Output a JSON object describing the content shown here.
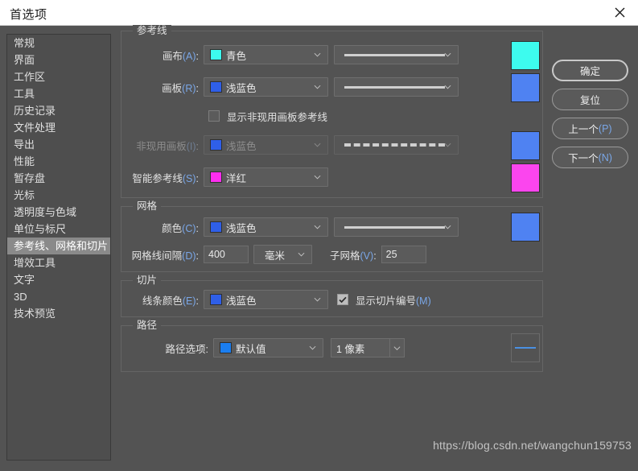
{
  "window": {
    "title": "首选项",
    "close_icon": "close-icon"
  },
  "sidebar": {
    "items": [
      {
        "label": "常规",
        "selected": false
      },
      {
        "label": "界面",
        "selected": false
      },
      {
        "label": "工作区",
        "selected": false
      },
      {
        "label": "工具",
        "selected": false
      },
      {
        "label": "历史记录",
        "selected": false
      },
      {
        "label": "文件处理",
        "selected": false
      },
      {
        "label": "导出",
        "selected": false
      },
      {
        "label": "性能",
        "selected": false
      },
      {
        "label": "暂存盘",
        "selected": false
      },
      {
        "label": "光标",
        "selected": false
      },
      {
        "label": "透明度与色域",
        "selected": false
      },
      {
        "label": "单位与标尺",
        "selected": false
      },
      {
        "label": "参考线、网格和切片",
        "selected": true
      },
      {
        "label": "增效工具",
        "selected": false
      },
      {
        "label": "文字",
        "selected": false
      },
      {
        "label": "3D",
        "selected": false
      },
      {
        "label": "技术预览",
        "selected": false
      }
    ]
  },
  "buttons": {
    "ok": "确定",
    "reset": "复位",
    "prev": "上一个(P)",
    "prev_plain": "上一个",
    "prev_key": "(P)",
    "next_plain": "下一个",
    "next_key": "(N)"
  },
  "guides": {
    "title": "参考线",
    "canvas": {
      "label_text": "画布",
      "label_key": "(A)",
      "color_name": "青色",
      "color_hex": "#3dfbee",
      "style": "solid",
      "chip_hex": "#3dfbee"
    },
    "artboard": {
      "label_text": "画板",
      "label_key": "(R)",
      "color_name": "浅蓝色",
      "color_hex": "#2f5fe8",
      "style": "solid",
      "chip_hex": "#4f82f2"
    },
    "show_inactive_checkbox": {
      "label": "显示非现用画板参考线",
      "checked": false
    },
    "inactive_artboard": {
      "label_text": "非现用画板",
      "label_key": "(I)",
      "color_name": "浅蓝色",
      "color_hex": "#2f5fe8",
      "style": "dashed",
      "chip_hex": "#4f82f2",
      "disabled": true
    },
    "smart_guides": {
      "label_text": "智能参考线",
      "label_key": "(S)",
      "color_name": "洋红",
      "color_hex": "#ff2df0",
      "chip_hex": "#fb45ee"
    }
  },
  "grid": {
    "title": "网格",
    "color": {
      "label_text": "颜色",
      "label_key": "(C)",
      "color_name": "浅蓝色",
      "color_hex": "#2f5fe8",
      "style": "solid",
      "chip_hex": "#4f82f2"
    },
    "gridline_every": {
      "label_text": "网格线间隔",
      "label_key": "(D)",
      "value": "400",
      "unit": "毫米"
    },
    "subdivisions": {
      "label_text": "子网格",
      "label_key": "(V)",
      "value": "25"
    }
  },
  "slices": {
    "title": "切片",
    "line_color": {
      "label_text": "线条颜色",
      "label_key": "(E)",
      "color_name": "浅蓝色",
      "color_hex": "#2f5fe8"
    },
    "show_numbers": {
      "label_text": "显示切片编号",
      "label_key": "(M)",
      "checked": true
    }
  },
  "paths": {
    "title": "路径",
    "path_options": {
      "label_text": "路径选项",
      "label_key": "",
      "value_name": "默认值",
      "color_hex": "#1b7ef0",
      "width_value": "1 像素"
    }
  },
  "watermark": "https://blog.csdn.net/wangchun159753"
}
